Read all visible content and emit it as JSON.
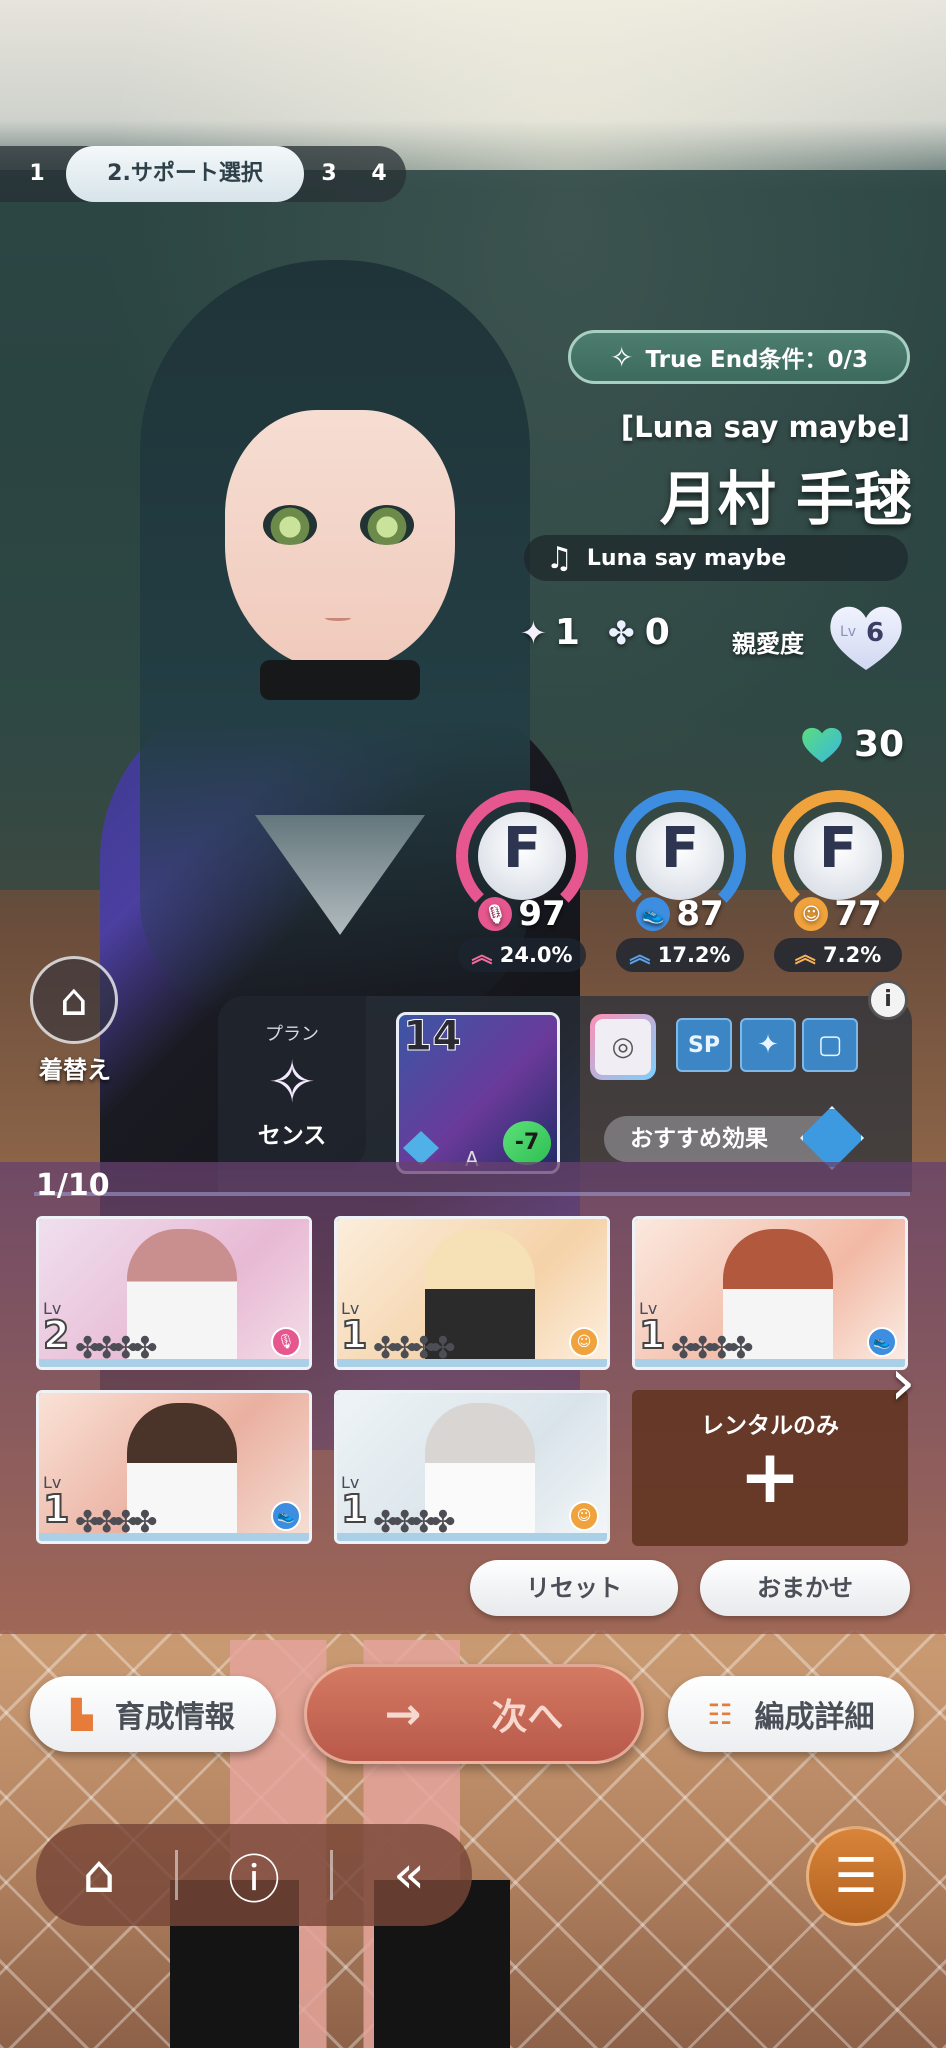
{
  "steps": [
    "1",
    "2.サポート選択",
    "3",
    "4"
  ],
  "true_end": {
    "icon": "sparkle-icon",
    "label": "True End条件：0/3"
  },
  "idol": {
    "subtitle": "[Luna say maybe]",
    "name": "月村 手毬",
    "song": "Luna say maybe",
    "sp_count": "1",
    "clover_count": "0",
    "affinity_label": "親愛度",
    "affinity_lv_prefix": "Lv",
    "affinity_level": "6",
    "stamina": "30"
  },
  "stats": [
    {
      "grade": "F",
      "value": "97",
      "bonus": "24.0%",
      "color": "#e6578f",
      "icon": "mic-icon"
    },
    {
      "grade": "F",
      "value": "87",
      "bonus": "17.2%",
      "color": "#3d8de0",
      "icon": "dance-icon"
    },
    {
      "grade": "F",
      "value": "77",
      "bonus": "7.2%",
      "color": "#f0a23c",
      "icon": "visual-icon"
    }
  ],
  "costume_label": "着替え",
  "plan": {
    "title": "プラン",
    "name": "センス",
    "icon": "sense-star-icon"
  },
  "memory_card": {
    "level": "14",
    "bonus": "-7",
    "grade": "A"
  },
  "skills": [
    "SP"
  ],
  "recommend_label": "おすすめ効果",
  "deck": {
    "count": "1/10",
    "cards": [
      {
        "lv": "2",
        "type": "vocal"
      },
      {
        "lv": "1",
        "type": "visual"
      },
      {
        "lv": "1",
        "type": "dance"
      },
      {
        "lv": "1",
        "type": "dance"
      },
      {
        "lv": "1",
        "type": "visual"
      }
    ],
    "lv_prefix": "Lv",
    "rental_label": "レンタルのみ",
    "rental_plus": "+"
  },
  "buttons": {
    "reset": "リセット",
    "auto": "おまかせ",
    "train_info": "育成情報",
    "next": "次へ",
    "formation": "編成詳細"
  },
  "colors": {
    "vocal": "#e6578f",
    "dance": "#3d8de0",
    "visual": "#f0a23c",
    "accent": "#e77b3a"
  }
}
